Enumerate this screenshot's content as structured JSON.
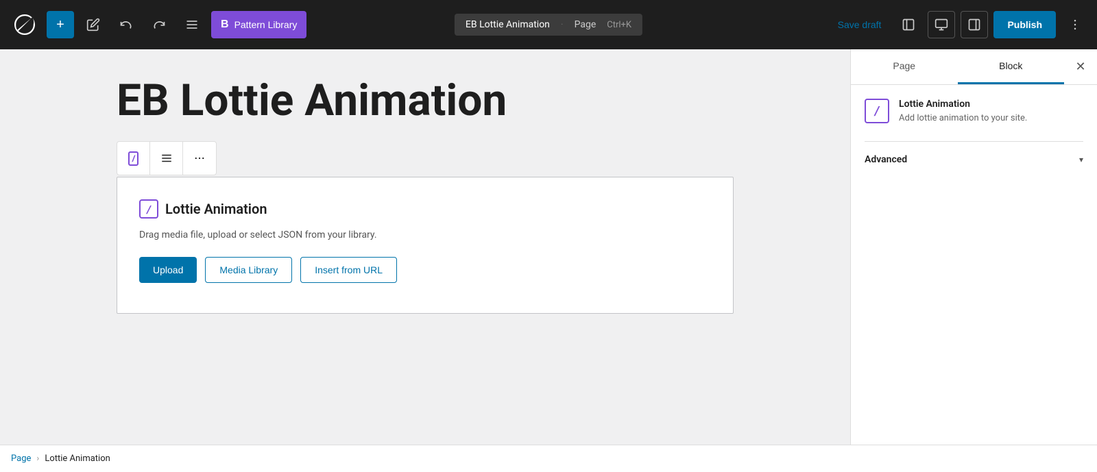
{
  "topbar": {
    "wp_logo_label": "WordPress",
    "add_button_label": "+",
    "tool_edit_label": "Edit",
    "undo_label": "Undo",
    "redo_label": "Redo",
    "list_view_label": "List View",
    "pattern_library_label": "Pattern Library",
    "document_title": "EB Lottie Animation",
    "document_subtitle": "Page",
    "shortcut": "Ctrl+K",
    "save_draft_label": "Save draft",
    "view_label": "View",
    "settings_label": "Settings",
    "sidebar_label": "Sidebar",
    "publish_label": "Publish",
    "more_label": "More"
  },
  "sidebar": {
    "page_tab_label": "Page",
    "block_tab_label": "Block",
    "close_label": "Close",
    "block_icon_label": "/",
    "block_title": "Lottie Animation",
    "block_description": "Add lottie animation to your site.",
    "advanced_label": "Advanced"
  },
  "editor": {
    "page_title": "EB Lottie Animation",
    "block_toolbar": {
      "edit_icon": "/",
      "align_icon": "≡",
      "more_icon": "⋮"
    },
    "lottie_block": {
      "icon_label": "/",
      "title": "Lottie Animation",
      "description": "Drag media file, upload or select JSON from your library.",
      "upload_btn": "Upload",
      "media_library_btn": "Media Library",
      "insert_url_btn": "Insert from URL"
    }
  },
  "breadcrumb": {
    "page_label": "Page",
    "separator": "›",
    "current_label": "Lottie Animation"
  }
}
